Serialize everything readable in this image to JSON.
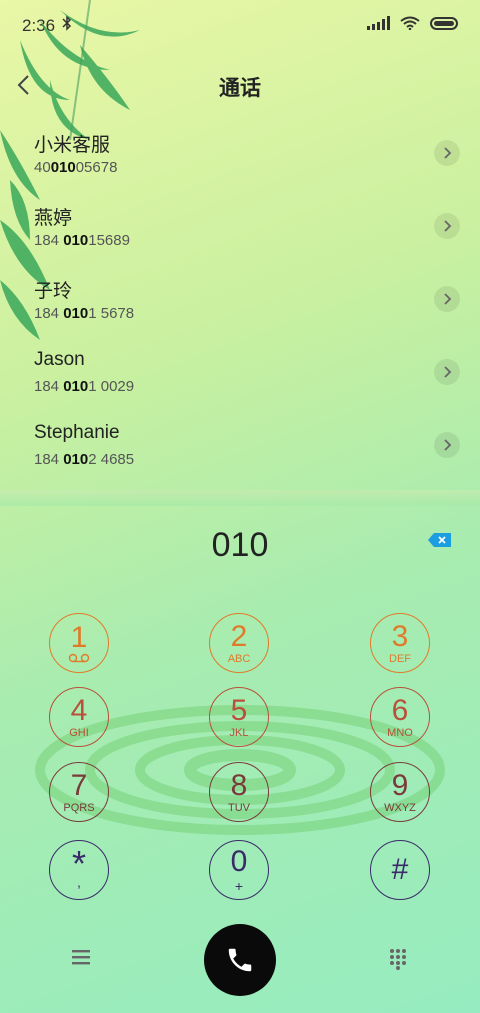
{
  "status": {
    "time": "2:36"
  },
  "header": {
    "title": "通话"
  },
  "contacts": [
    {
      "name": "小米客服",
      "num_pre": "40",
      "num_match": "010",
      "num_post": "05678"
    },
    {
      "name": "燕婷",
      "num_pre": "184 ",
      "num_match": "010",
      "num_post": "15689"
    },
    {
      "name": "子玲",
      "num_pre": "184 ",
      "num_match": "010",
      "num_post": "1 5678"
    },
    {
      "name": "Jason",
      "num_pre": "184 ",
      "num_match": "010",
      "num_post": "1 0029"
    },
    {
      "name": "Stephanie",
      "num_pre": "184 ",
      "num_match": "010",
      "num_post": "2 4685"
    }
  ],
  "dialer": {
    "dialed_number": "010",
    "keys": [
      {
        "digit": "1",
        "letters": ""
      },
      {
        "digit": "2",
        "letters": "ABC"
      },
      {
        "digit": "3",
        "letters": "DEF"
      },
      {
        "digit": "4",
        "letters": "GHI"
      },
      {
        "digit": "5",
        "letters": "JKL"
      },
      {
        "digit": "6",
        "letters": "MNO"
      },
      {
        "digit": "7",
        "letters": "PQRS"
      },
      {
        "digit": "8",
        "letters": "TUV"
      },
      {
        "digit": "9",
        "letters": "WXYZ"
      },
      {
        "digit": "*",
        "letters": ","
      },
      {
        "digit": "0",
        "letters": "+"
      },
      {
        "digit": "#",
        "letters": ""
      }
    ]
  },
  "colors": {
    "call_button": "#0a0a0a",
    "delete_accent": "#1a9ee0"
  },
  "icons": [
    "bluetooth-icon",
    "signal-icon",
    "wifi-icon",
    "battery-icon",
    "back-arrow-icon",
    "chevron-right-icon",
    "voicemail-icon",
    "backspace-icon",
    "menu-icon",
    "phone-icon",
    "keypad-icon"
  ]
}
